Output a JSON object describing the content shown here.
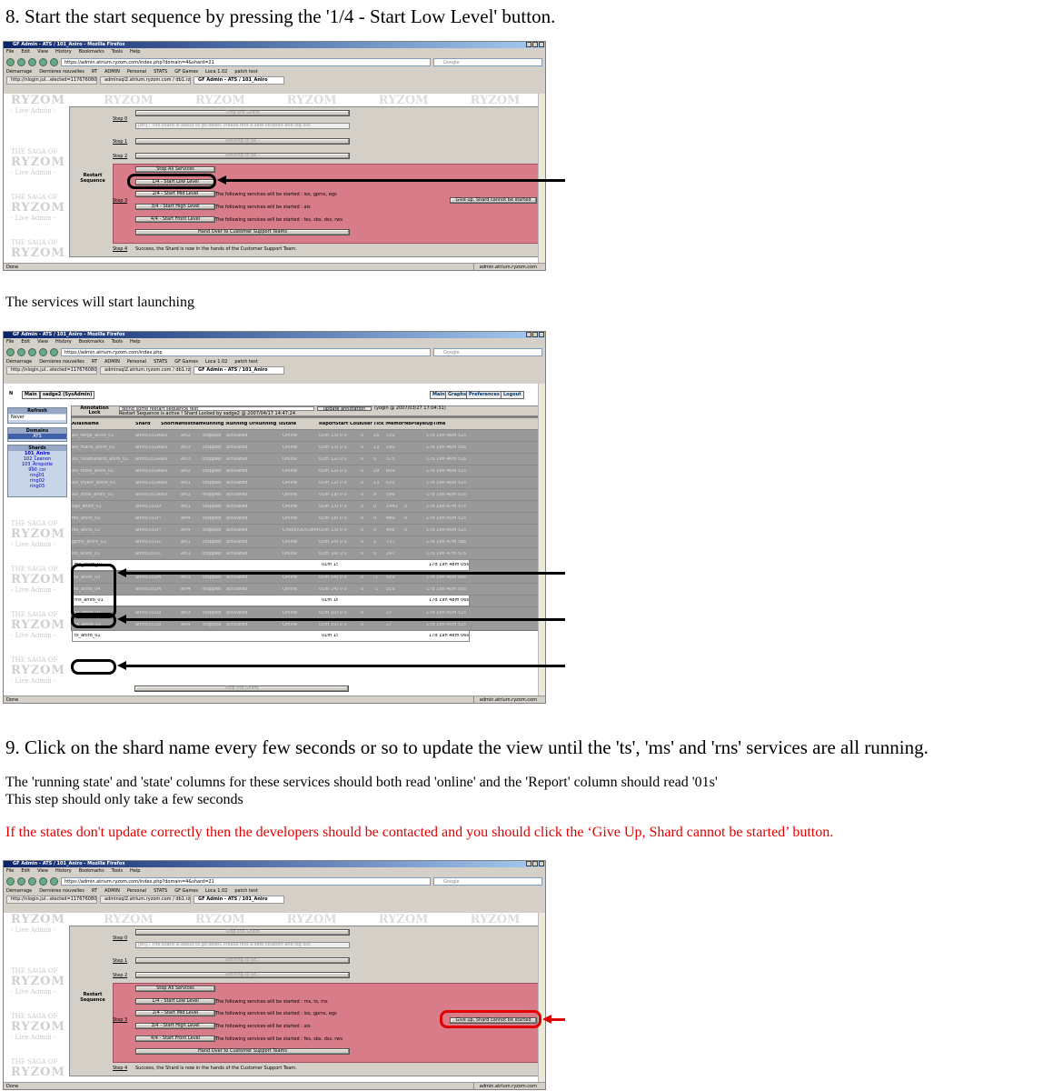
{
  "step8": {
    "heading": "8. Start the start sequence by pressing the '1/4 - Start Low Level' button.",
    "caption": "The services will start launching"
  },
  "step9": {
    "heading": "9. Click on the shard name every few seconds or so to update the view until the 'ts', 'ms' and 'rns' services are all running.",
    "line1": "The 'running state' and 'state' columns for these services should both read 'online' and the 'Report' column should read '01s'",
    "line2": "This step should only take a few seconds",
    "warning": "If the states don't update correctly then the developers should be contacted and you should click the ‘Give Up, Shard cannot be started’ button."
  },
  "colors": {
    "warning": "#e00000",
    "restart_panel": "#d87c89",
    "titlebar": "#0a246a"
  },
  "browser": {
    "title_a": "GF Admin - ATS / 101_Aniro - Mozilla Firefox",
    "title_b": "GF Admin - ATS / 101_Aniro - Mozilla Firefox",
    "menu": [
      "File",
      "Edit",
      "View",
      "History",
      "Bookmarks",
      "Tools",
      "Help"
    ],
    "url_a": "https://admin.atrium.ryzom.com/index.php?domain=4&shard=21",
    "url_b": "https://admin.atrium.ryzom.com/index.php",
    "search_placeholder": "Google",
    "bookmarks": [
      "Démarrage",
      "Dernières nouvelles",
      "RT",
      "ADMIN",
      "Personal",
      "STATS",
      "GF Games",
      "Loca 1.02",
      "patch test"
    ],
    "tabs": [
      "http://nlogin.jul...elected=1176760800...",
      "adminsql2.atrium.ryzom.com / db1.rzl...",
      "GF Admin - ATS / 101_Aniro"
    ],
    "tabs_b": [
      "http://nlogin.jul...elected=1176760800...",
      "adminsql2.atrium.ryzom.com / db1.rzl...",
      "GF Admin - ATS / 101_Aniro"
    ],
    "status_left": "Done",
    "status_right": "admin.atrium.ryzom.com"
  },
  "sequence": {
    "restart_label": "Restart Sequence",
    "step0": "Step 0",
    "stop_shard": "Stop the Shard",
    "message": "[en] : The shard is about to go down. Please find a safe location and log out.",
    "step1": "Step 1",
    "nothing1": "Nothing to do !",
    "step2": "Step 2",
    "nothing2": "Nothing to do !",
    "step3": "Step 3",
    "stop_all": "Stop All Services",
    "b1": "1/4 - Start Low Level",
    "b2": "2/4 - Start Mid Level",
    "b3": "3/4 - Start High Level",
    "b4": "4/4 - Start Front Level",
    "t2": "The following services will be started : ios, gpms, egs",
    "t3": "The following services will be started : ais",
    "t4": "The following services will be started : fes, sbs, dss, rws",
    "t1b": "The following services will be started : rns, ts, ms",
    "handover": "Hand Over to Customer Support Teams",
    "giveup": "Give up, Shard cannot be started",
    "step4": "Step 4",
    "step4_text": "Success, the Shard is now in the hands of the Customer Support Team."
  },
  "watermark": {
    "brand": "RYZOM",
    "saga": "THE SAGA OF",
    "live": "- Live Admin -"
  },
  "admin": {
    "main_tab": "Main",
    "user": "sadge2 (SysAdmin)",
    "links": [
      "Main",
      "Graphs",
      "Preferences",
      "Logout"
    ],
    "refresh": "Refresh",
    "refresh_val": "Never",
    "annotation": "Annotation",
    "lock": "Lock",
    "annotation_val": "doing some restart sequence test",
    "update_btn": "update annotation",
    "annotation_by": "(yogin @ 2007/03/27 17:04:31)",
    "lock_text": "Restart Sequence is active ! Shard Locked by sadge2 @ 2007/04/17 14:47:24",
    "domains": "Domains",
    "domain_val": "ATS",
    "shards": "Shards",
    "shard_list": [
      "101_Aniro",
      "102_Leanon",
      "103_Arispotle",
      "990_csr",
      "ring01",
      "ring02",
      "ring03"
    ],
    "columns": [
      "AliasName",
      "Shard",
      "ShortName",
      "Hostname",
      "Running State",
      "Running Orders",
      "Running Tags",
      "State",
      "Report",
      "Start Counters",
      "User SL",
      "Tick SL",
      "Memory",
      "NbPlayers",
      "UpTime"
    ],
    "rows": [
      [
        "ais_forge_aniro_01",
        "aniro/101AIS",
        "ais",
        "ani2",
        "stopped",
        "activated",
        "",
        "Online",
        "01m 13s",
        "0 0 0",
        "0",
        "16",
        "531",
        "",
        "17d 19h 46m 51s"
      ],
      [
        "ais_matis_aniro_01",
        "aniro/101AIS",
        "ais",
        "ani3",
        "stopped",
        "activated",
        "",
        "Online",
        "01m 13s",
        "0 0 0",
        "0",
        "13",
        "590",
        "",
        "17d 19h 46m 50s"
      ],
      [
        "ais_newbieland_aniro_01",
        "aniro/101AIS",
        "ais",
        "ani3",
        "stopped",
        "activated",
        "",
        "Online",
        "01m 12s",
        "0 0 0",
        "0",
        "0",
        "375",
        "",
        "17d 19h 46m 51s"
      ],
      [
        "ais_roots_aniro_01",
        "aniro/101AIS",
        "ais",
        "ani2",
        "stopped",
        "activated",
        "",
        "Online",
        "01m 12s",
        "0 0 0",
        "0",
        "29",
        "609",
        "",
        "17d 19h 46m 51s"
      ],
      [
        "ais_tryker_aniro_01",
        "aniro/101AIS",
        "ais",
        "ani1",
        "stopped",
        "activated",
        "",
        "Online",
        "01m 12s",
        "0 0 0",
        "0",
        "13",
        "610",
        "",
        "17d 19h 46m 51s"
      ],
      [
        "ais_zorai_aniro_01",
        "aniro/101AIS",
        "ais",
        "ani2",
        "stopped",
        "activated",
        "",
        "Online",
        "01m 11s",
        "0 0 0",
        "0",
        "9",
        "596",
        "",
        "17d 19h 46m 51s"
      ],
      [
        "egs_aniro_01",
        "aniro/101EGS",
        "",
        "ani1",
        "stopped",
        "activated",
        "",
        "Online",
        "01m 13s",
        "0 0 0",
        "0",
        "0",
        "1441",
        "0",
        "17d 19h 47m 57s"
      ],
      [
        "fes_aniro_01",
        "aniro/101FS",
        "",
        "ani4",
        "stopped",
        "activated",
        "",
        "Online",
        "01m 11s",
        "0 0 0",
        "0",
        "0",
        "480",
        "0",
        "17d 19h 45m 51s"
      ],
      [
        "fes_aniro_02",
        "aniro/101FS",
        "",
        "ani4",
        "stopped",
        "activated",
        "",
        "Check(UD/Comm)",
        "01m 13s",
        "0 0 0",
        "0",
        "0",
        "456",
        "0",
        "17d 19h 45m 51s"
      ],
      [
        "gpms_aniro_01",
        "aniro/101GPMS",
        "",
        "ani1",
        "stopped",
        "activated",
        "",
        "Online",
        "01m 14s",
        "0 0 0",
        "0",
        "1",
        "737",
        "",
        "17d 19h 47m 56s"
      ],
      [
        "ios_aniro_01",
        "aniro/101IOS",
        "",
        "ani1",
        "stopped",
        "activated",
        "",
        "Online",
        "01m 14s",
        "0 0 0",
        "0",
        "0",
        "247",
        "",
        "17d 19h 47m 57s"
      ],
      [
        "ms_aniro_01",
        "",
        "",
        "",
        "",
        "",
        "",
        "",
        "01m 15s",
        "",
        "",
        "",
        "",
        "",
        "17d 19h 48m 05s"
      ],
      [
        "ms_aniro_02",
        "aniro/101MS",
        "",
        "ani2",
        "stopped",
        "activated",
        "",
        "Online",
        "01m 15s",
        "0 0 0",
        "0",
        "-1",
        "559",
        "",
        "17d 19h 46m 05s"
      ],
      [
        "ms_aniro_03",
        "aniro/101MS",
        "",
        "ani3",
        "stopped",
        "activated",
        "",
        "Online",
        "01m 14s",
        "0 0 0",
        "0",
        "-1",
        "559",
        "",
        "17d 19h 46m 06s"
      ],
      [
        "ms_aniro_04",
        "aniro/101MS",
        "",
        "ani4",
        "stopped",
        "activated",
        "",
        "Online",
        "01m 14s",
        "0 0 0",
        "0",
        "-1",
        "516",
        "",
        "17d 19h 46m 05s"
      ],
      [
        "rns_aniro_01",
        "",
        "",
        "",
        "",
        "",
        "",
        "",
        "01m 16s",
        "",
        "",
        "",
        "",
        "",
        "17d 19h 48m 06s"
      ],
      [
        "rws_aniro_01",
        "aniro/101RWS",
        "",
        "ani1",
        "stopped",
        "activated",
        "",
        "Open",
        "01m 10s",
        "0 0 0",
        "0",
        "",
        "25",
        "",
        "17d 19h 45m 51s"
      ],
      [
        "sbs_aniro_01",
        "aniro/101SBS",
        "",
        "ani3",
        "stopped",
        "activated",
        "",
        "Online",
        "01m 10s",
        "0 0 0",
        "0",
        "",
        "27",
        "",
        "17d 19h 45m 51s"
      ],
      [
        "sbs_aniro_02",
        "aniro/101SBS",
        "",
        "ani4",
        "stopped",
        "activated",
        "",
        "Online",
        "01m 10s",
        "0 0 0",
        "0",
        "",
        "27",
        "",
        "17d 19h 45m 51s"
      ],
      [
        "ts_aniro_01",
        "",
        "",
        "",
        "",
        "",
        "",
        "",
        "01m 15s",
        "",
        "",
        "",
        "",
        "",
        "17d 19h 48m 06s"
      ]
    ],
    "stop_shard": "Stop the Shard",
    "callouts": [
      "ms_aniro_01",
      "ms_aniro_02",
      "ms_aniro_03",
      "ms_aniro_04",
      "rns_aniro_01",
      "ts_aniro_01"
    ]
  }
}
